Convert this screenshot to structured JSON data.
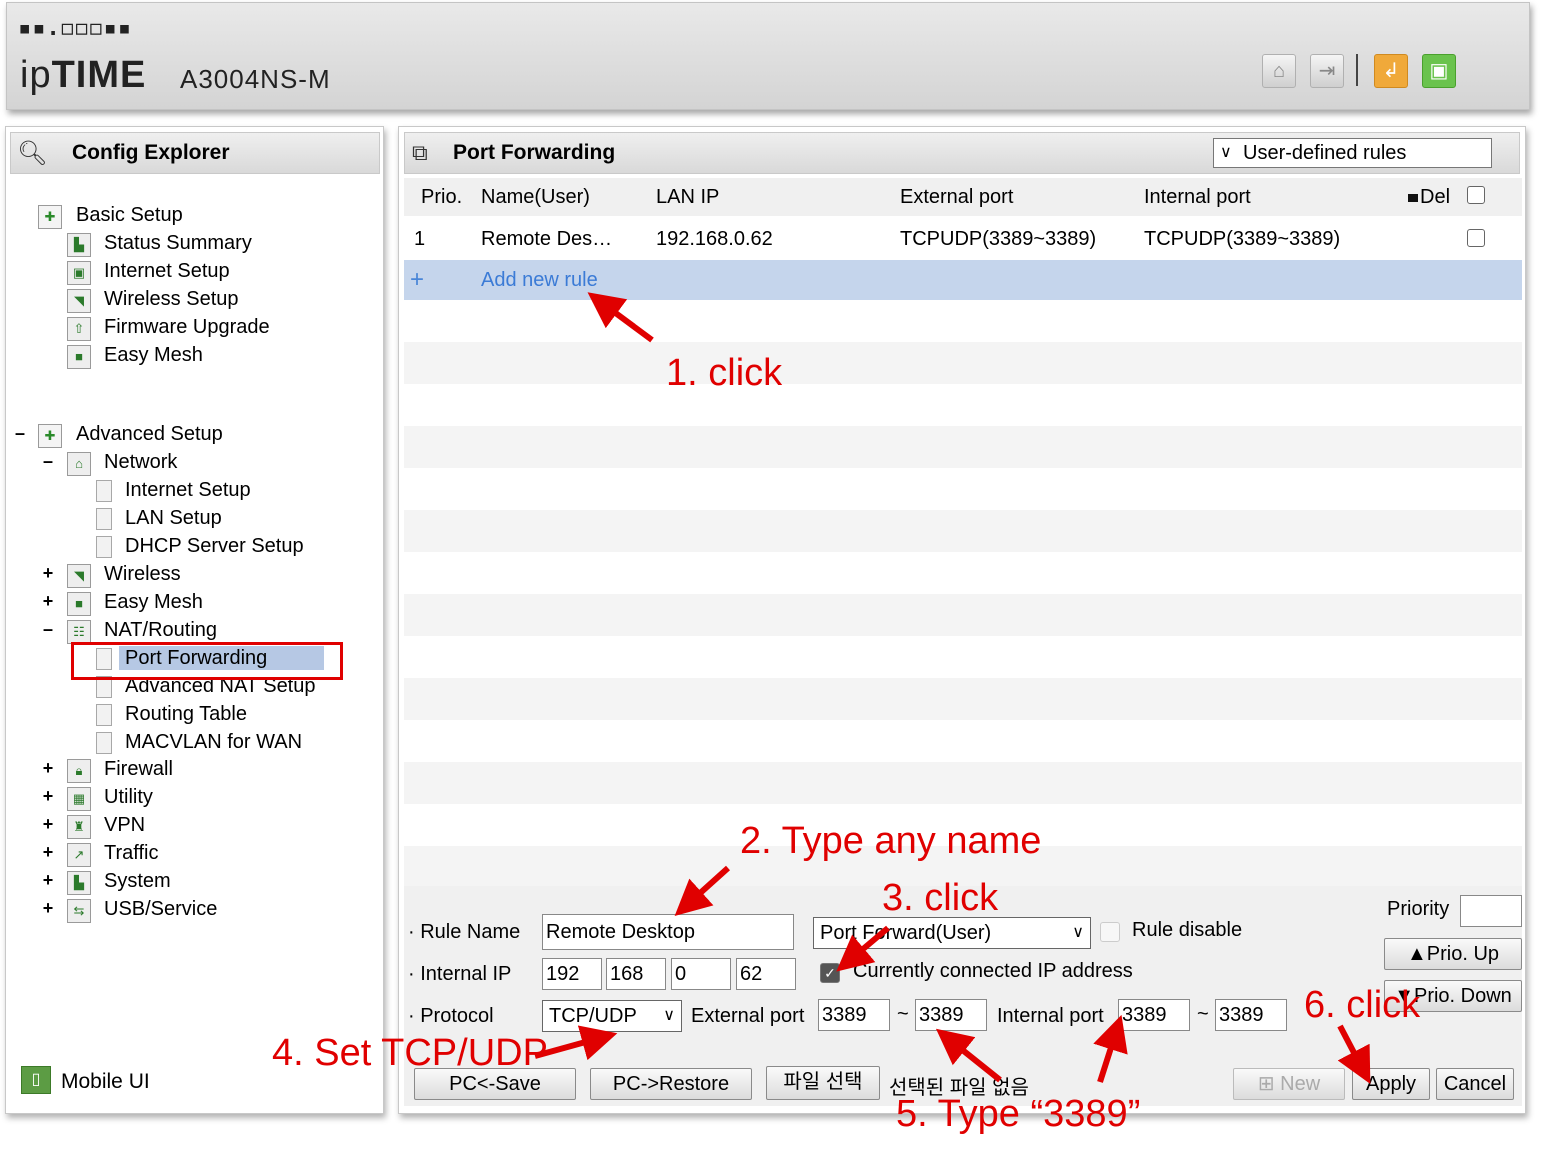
{
  "header": {
    "logo_dots": "▪▪.◻◻◻▪▪",
    "brand_prefix": "ip",
    "brand_main": "TIME",
    "model": "A3004NS-M",
    "icons": [
      "home-icon",
      "logout-icon",
      "restore-icon",
      "save-icon"
    ]
  },
  "explorer": {
    "title": "Config Explorer",
    "basic_setup": {
      "label": "Basic Setup",
      "items": [
        "Status Summary",
        "Internet Setup",
        "Wireless Setup",
        "Firmware Upgrade",
        "Easy Mesh"
      ]
    },
    "advanced_setup": {
      "label": "Advanced Setup",
      "network": {
        "label": "Network",
        "items": [
          "Internet Setup",
          "LAN Setup",
          "DHCP Server Setup"
        ]
      },
      "wireless": "Wireless",
      "easy_mesh": "Easy Mesh",
      "nat": {
        "label": "NAT/Routing",
        "items": [
          "Port Forwarding",
          "Advanced NAT Setup",
          "Routing Table",
          "MACVLAN for WAN"
        ]
      },
      "others": [
        "Firewall",
        "Utility",
        "VPN",
        "Traffic",
        "System",
        "USB/Service"
      ]
    },
    "mobile_ui": "Mobile UI",
    "selected": "Port Forwarding"
  },
  "main": {
    "title": "Port Forwarding",
    "rules_filter": "User-defined rules",
    "columns": [
      "Prio.",
      "Name(User)",
      "LAN IP",
      "External port",
      "Internal port",
      "Del"
    ],
    "rows": [
      {
        "prio": "1",
        "name": "Remote Des…",
        "lan_ip": "192.168.0.62",
        "external": "TCPUDP(3389~3389)",
        "internal": "TCPUDP(3389~3389)"
      }
    ],
    "add_rule_label": "Add new rule"
  },
  "form": {
    "rule_name_label": "Rule Name",
    "rule_name_value": "Remote Desktop",
    "rule_type": "Port Forward(User)",
    "rule_disable_label": "Rule disable",
    "priority_label": "Priority",
    "priority_value": "",
    "prio_up": "▲Prio. Up",
    "prio_down": "▼Prio. Down",
    "internal_ip_label": "Internal IP",
    "ip": [
      "192",
      "168",
      "0",
      "62"
    ],
    "current_ip_label": "Currently connected IP address",
    "current_ip_checked": true,
    "protocol_label": "Protocol",
    "protocol_value": "TCP/UDP",
    "external_port_label": "External port",
    "external_port_from": "3389",
    "external_port_to": "3389",
    "internal_port_label": "Internal port",
    "internal_port_from": "3389",
    "internal_port_to": "3389",
    "tilde": "~",
    "pc_save": "PC<-Save",
    "pc_restore": "PC->Restore",
    "file_select": "파일 선택",
    "file_status": "선택된 파일 없음",
    "new": "New",
    "apply": "Apply",
    "cancel": "Cancel"
  },
  "annotations": {
    "step1": "1. click",
    "step2": "2. Type any name",
    "step3": "3. click",
    "step4": "4. Set TCP/UDP",
    "step5": "5. Type “3389”",
    "step6": "6. click"
  }
}
